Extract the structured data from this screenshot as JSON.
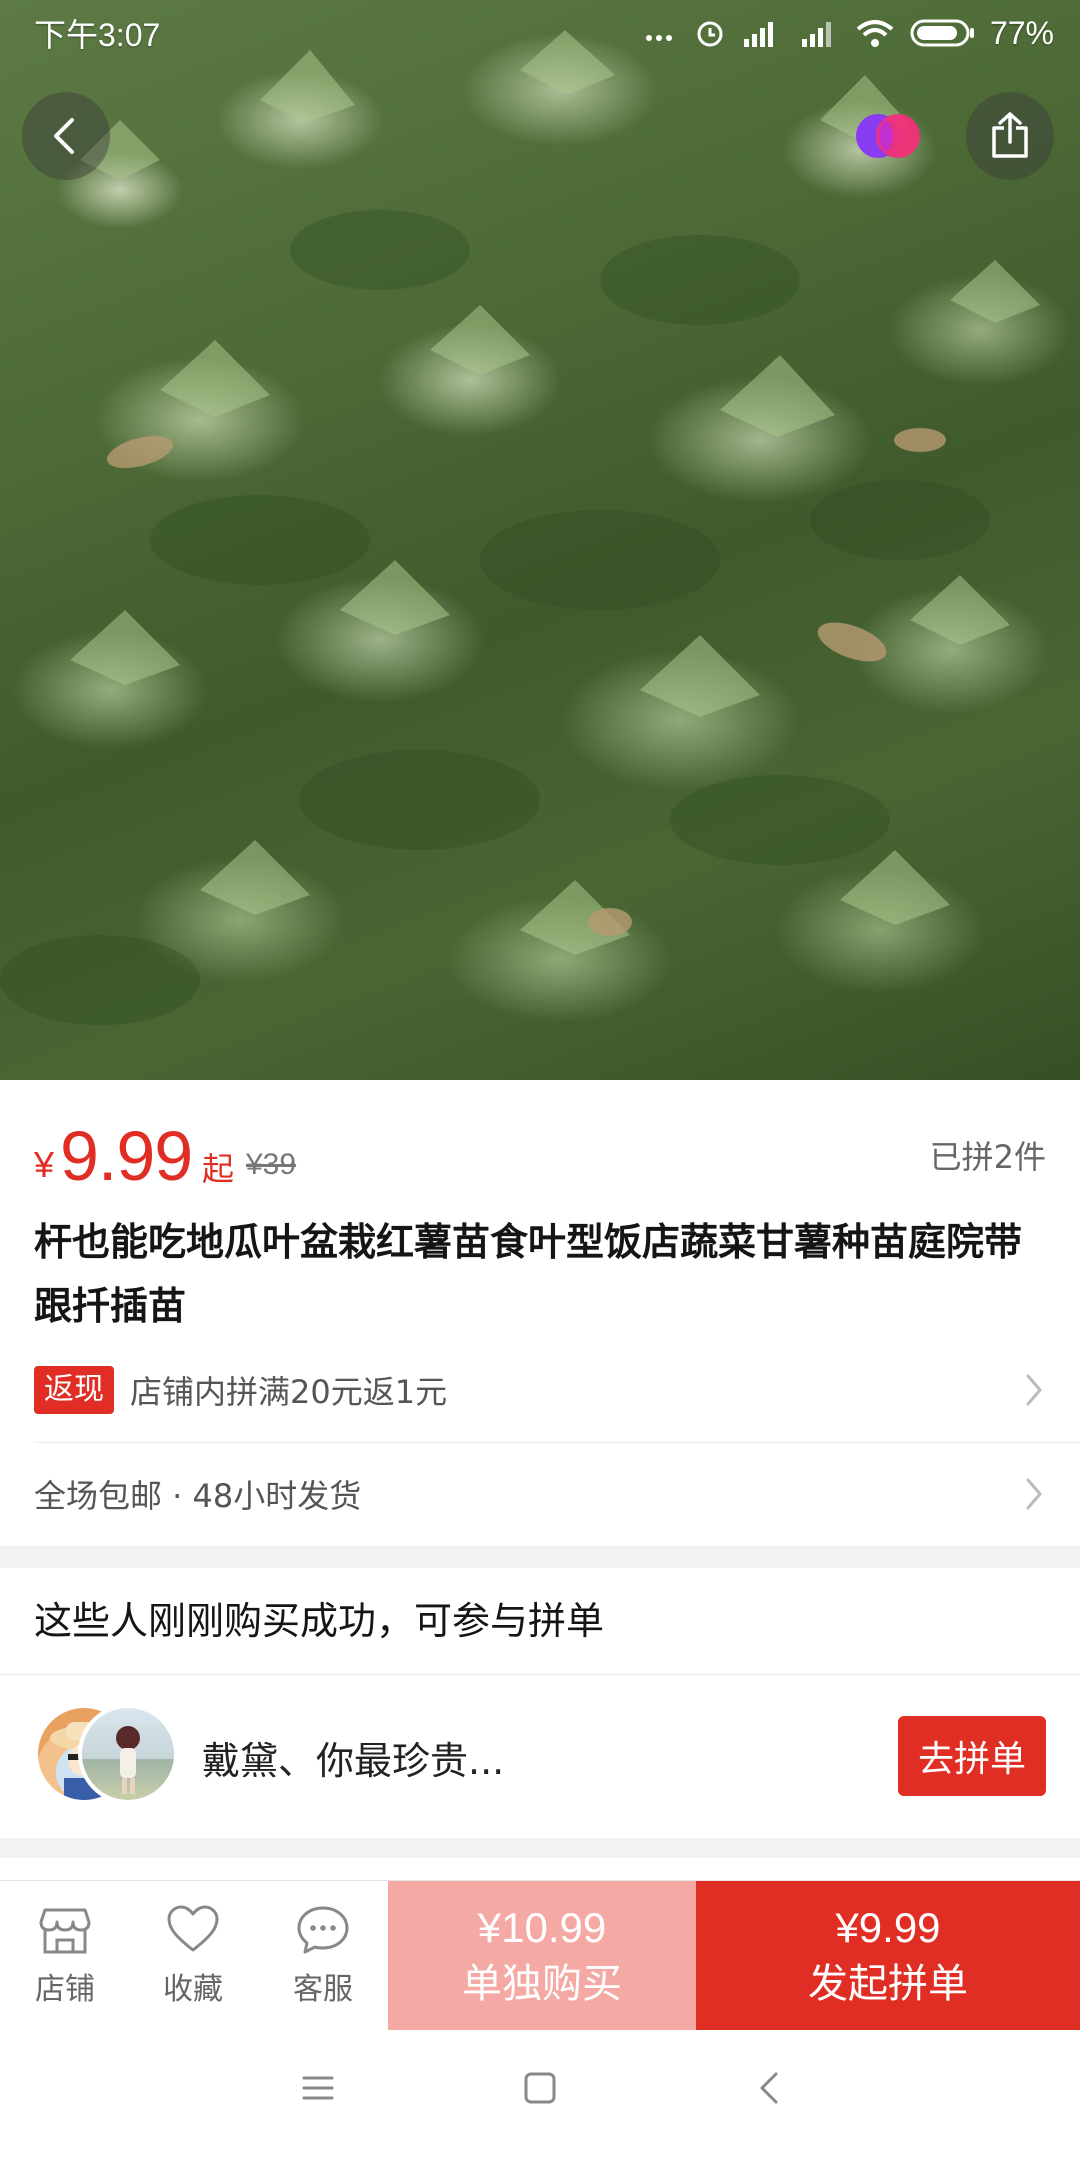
{
  "status_bar": {
    "time": "下午3:07",
    "battery": "77%"
  },
  "icons": {
    "back": "chevron-left-icon",
    "share": "share-icon",
    "brand": "pinduoduo-logo-icon",
    "shop": "store-icon",
    "favorite": "heart-icon",
    "service": "chat-bubble-icon"
  },
  "product": {
    "currency": "¥",
    "price": "9.99",
    "price_suffix": "起",
    "original_price": "¥39",
    "sold": "已拼2件",
    "title": "杆也能吃地瓜叶盆栽红薯苗食叶型饭店蔬菜甘薯种苗庭院带跟扦插苗"
  },
  "promo": {
    "badge": "返现",
    "text": "店铺内拼满20元返1元"
  },
  "shipping": {
    "text": "全场包邮 · 48小时发货"
  },
  "group_buy": {
    "header": "这些人刚刚购买成功，可参与拼单",
    "names": "戴黛、你最珍贵...",
    "join_label": "去拼单"
  },
  "bottom_bar": {
    "shop_label": "店铺",
    "favorite_label": "收藏",
    "service_label": "客服",
    "single_price": "¥10.99",
    "single_label": "单独购买",
    "group_price": "¥9.99",
    "group_label": "发起拼单"
  },
  "colors": {
    "accent": "#e02e24",
    "single_buy_bg": "#f4a9a4"
  }
}
